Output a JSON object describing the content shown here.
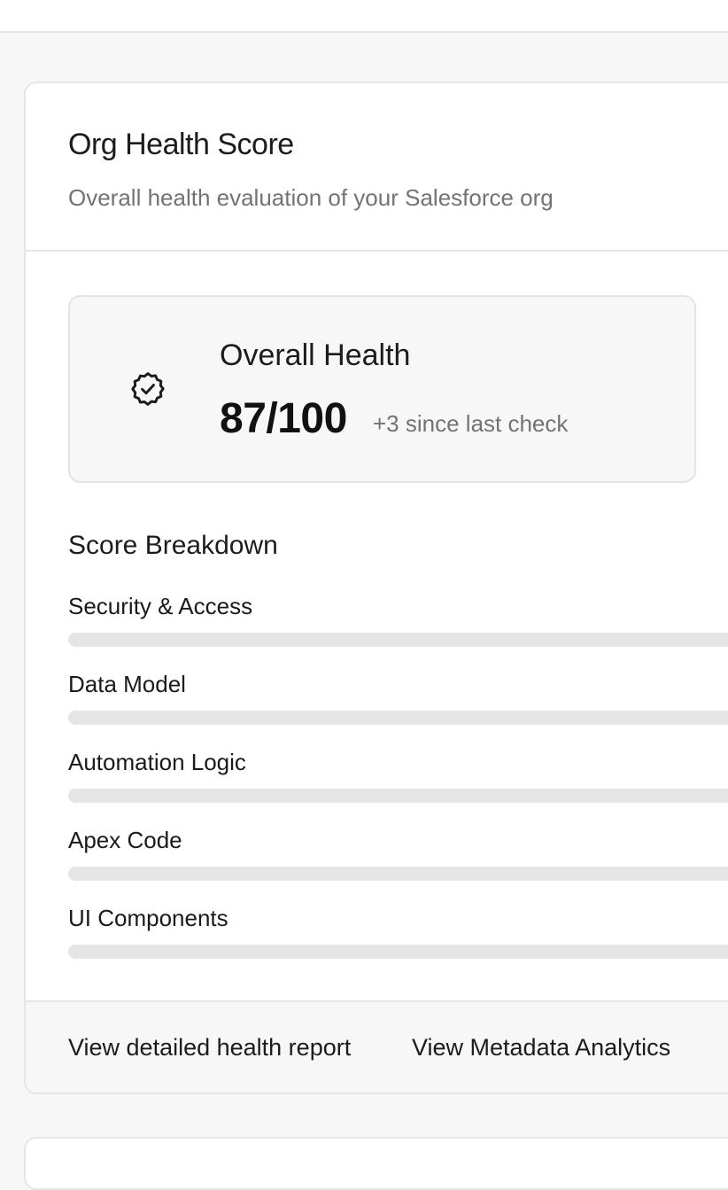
{
  "card": {
    "title": "Org Health Score",
    "subtitle": "Overall health evaluation of your Salesforce org"
  },
  "overall": {
    "icon": "badge-check-icon",
    "label": "Overall Health",
    "score": "87/100",
    "delta": "+3 since last check"
  },
  "breakdown": {
    "title": "Score Breakdown",
    "metrics": [
      {
        "label": "Security & Access"
      },
      {
        "label": "Data Model"
      },
      {
        "label": "Automation Logic"
      },
      {
        "label": "Apex Code"
      },
      {
        "label": "UI Components"
      }
    ]
  },
  "footer": {
    "report_link": "View detailed health report",
    "analytics_link": "View Metadata Analytics"
  },
  "colors": {
    "track": "#e5e5e5",
    "border": "#e6e6e6",
    "muted_text": "#737373"
  }
}
